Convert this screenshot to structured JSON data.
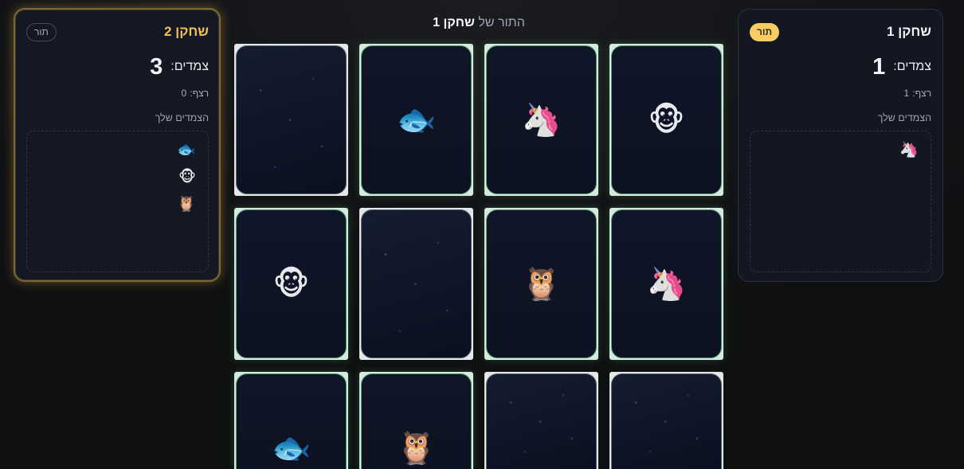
{
  "theme": {
    "accent": "#f2c14e",
    "badge": "#f5cd60",
    "matched_border": "#4f9a72",
    "background": "#111215"
  },
  "header": {
    "turn_prefix": "התור של",
    "turn_player": "שחקן 1"
  },
  "player1": {
    "name": "שחקן 1",
    "badge": "תור",
    "badge_filled": true,
    "highlighted": false,
    "pairs_label": "צמדים:",
    "pairs": 1,
    "streak_label": "רצף:",
    "streak": 1,
    "matches_title": "הצמדים שלך",
    "matches": [
      {
        "symbol": "🦄",
        "icon": "unicorn-icon"
      }
    ]
  },
  "player2": {
    "name": "שחקן 2",
    "badge": "תור",
    "badge_filled": false,
    "highlighted": true,
    "pairs_label": "צמדים:",
    "pairs": 3,
    "streak_label": "רצף:",
    "streak": 0,
    "matches_title": "הצמדים שלך",
    "matches": [
      {
        "symbol": "🐟",
        "icon": "fish-icon"
      },
      {
        "symbol": "🐵",
        "icon": "monkey-icon"
      },
      {
        "symbol": "🦉",
        "icon": "owl-icon"
      }
    ]
  },
  "board": {
    "cards": [
      {
        "symbol": "🐵",
        "icon": "monkey-icon",
        "face_up": true,
        "matched": true
      },
      {
        "symbol": "🦄",
        "icon": "unicorn-icon",
        "face_up": true,
        "matched": true
      },
      {
        "symbol": "🐟",
        "icon": "fish-icon",
        "face_up": true,
        "matched": true
      },
      {
        "face_up": false,
        "matched": false
      },
      {
        "symbol": "🦄",
        "icon": "unicorn-icon",
        "face_up": true,
        "matched": true
      },
      {
        "symbol": "🦉",
        "icon": "owl-icon",
        "face_up": true,
        "matched": true
      },
      {
        "face_up": false,
        "matched": false
      },
      {
        "symbol": "🐵",
        "icon": "monkey-icon",
        "face_up": true,
        "matched": true
      },
      {
        "face_up": false,
        "matched": false
      },
      {
        "face_up": false,
        "matched": false
      },
      {
        "symbol": "🦉",
        "icon": "owl-icon",
        "face_up": true,
        "matched": true
      },
      {
        "symbol": "🐟",
        "icon": "fish-icon",
        "face_up": true,
        "matched": true
      }
    ]
  }
}
